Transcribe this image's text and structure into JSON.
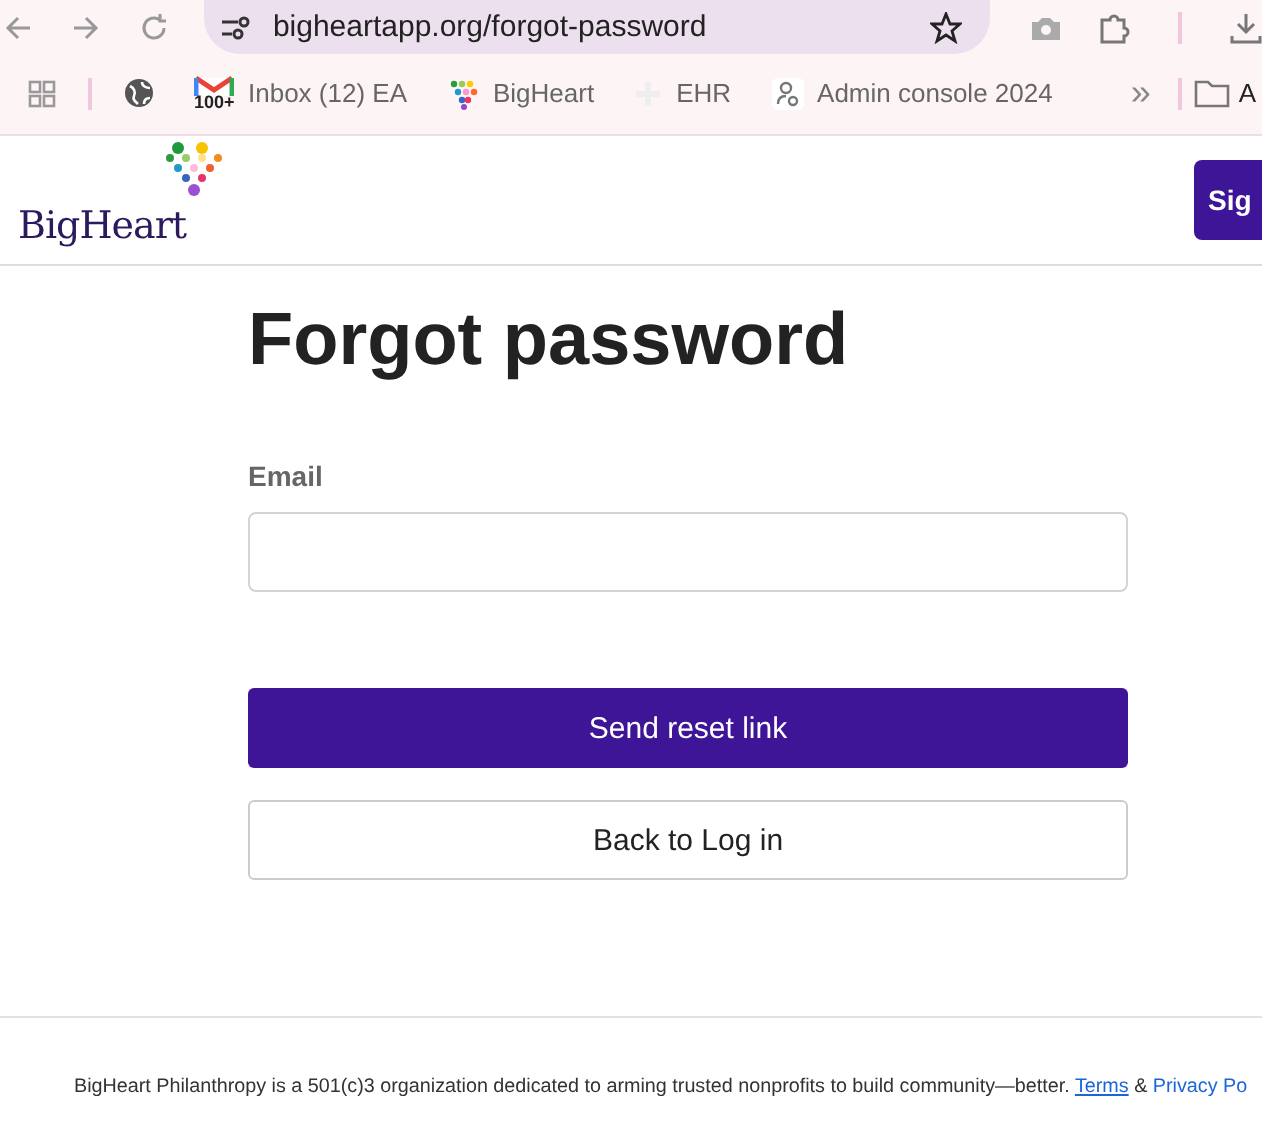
{
  "browser": {
    "url": "bigheartapp.org/forgot-password",
    "bookmarks": [
      {
        "kind": "apps"
      },
      {
        "kind": "globe"
      },
      {
        "label": "Inbox (12) EA",
        "kind": "mail",
        "badge": "100+"
      },
      {
        "label": "BigHeart",
        "kind": "heart"
      },
      {
        "label": "EHR",
        "kind": "plus"
      },
      {
        "label": "Admin console 2024",
        "kind": "admin"
      }
    ],
    "overflow": "»",
    "folder": "A"
  },
  "header": {
    "brand": "BigHeart",
    "button": "Sig"
  },
  "form": {
    "title": "Forgot password",
    "email_label": "Email",
    "submit": "Send reset link",
    "back": "Back to Log in"
  },
  "footer": {
    "text": "BigHeart Philanthropy is a 501(c)3 organization dedicated to arming trusted nonprofits to build community—better.",
    "links": [
      "Terms",
      "Privacy Po"
    ],
    "separator": "&"
  }
}
